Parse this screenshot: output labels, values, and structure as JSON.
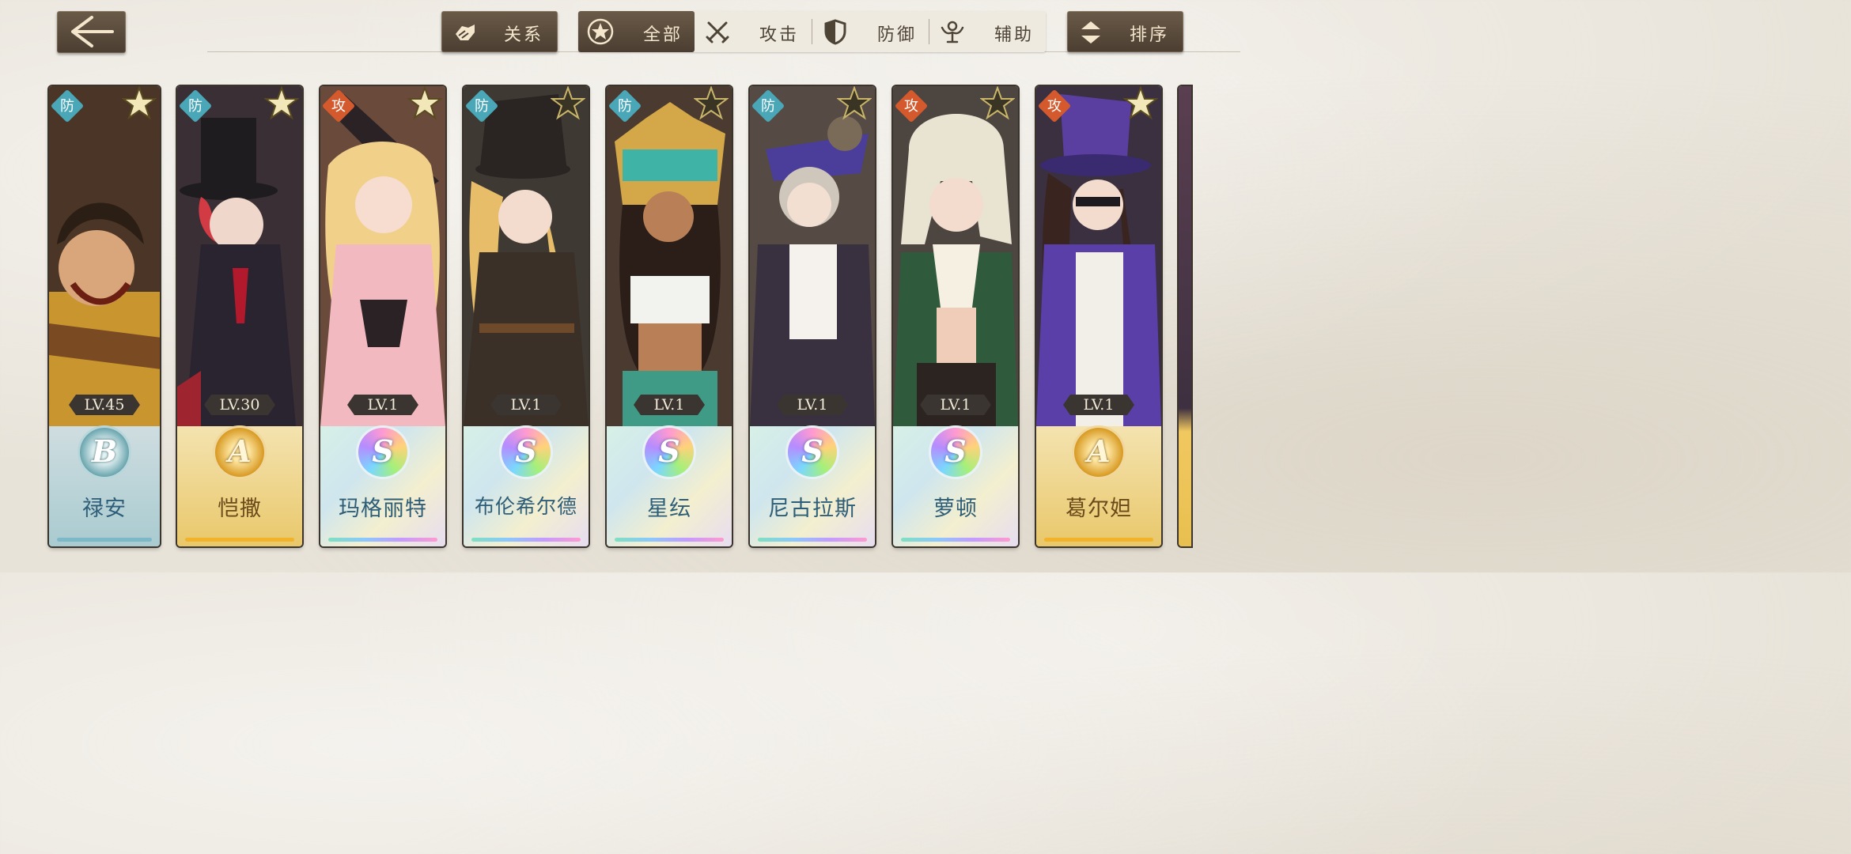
{
  "toolbar": {
    "back_icon": "back-arrow-icon",
    "relation_label": "关系",
    "relation_icon": "handshake-icon",
    "sort_label": "排序",
    "sort_icon": "sort-updown-icon"
  },
  "filters": [
    {
      "label": "全部",
      "icon": "star-circle-icon",
      "active": true
    },
    {
      "label": "攻击",
      "icon": "crossed-swords-icon",
      "active": false
    },
    {
      "label": "防御",
      "icon": "shield-icon",
      "active": false
    },
    {
      "label": "辅助",
      "icon": "support-figure-icon",
      "active": false
    }
  ],
  "cards": [
    {
      "name": "禄安",
      "level": "LV.45",
      "rank": "B",
      "role": "防",
      "role_type": "defense",
      "theme": "blue"
    },
    {
      "name": "恺撒",
      "level": "LV.30",
      "rank": "A",
      "role": "防",
      "role_type": "defense",
      "theme": "gold"
    },
    {
      "name": "玛格丽特",
      "level": "LV.1",
      "rank": "S",
      "role": "攻",
      "role_type": "attack",
      "theme": "rainbow"
    },
    {
      "name": "布伦希尔德",
      "level": "LV.1",
      "rank": "S",
      "role": "防",
      "role_type": "defense",
      "theme": "rainbow"
    },
    {
      "name": "星纭",
      "level": "LV.1",
      "rank": "S",
      "role": "防",
      "role_type": "defense",
      "theme": "rainbow"
    },
    {
      "name": "尼古拉斯",
      "level": "LV.1",
      "rank": "S",
      "role": "防",
      "role_type": "defense",
      "theme": "rainbow"
    },
    {
      "name": "萝顿",
      "level": "LV.1",
      "rank": "S",
      "role": "攻",
      "role_type": "attack",
      "theme": "rainbow"
    },
    {
      "name": "葛尔妲",
      "level": "LV.1",
      "rank": "A",
      "role": "攻",
      "role_type": "attack",
      "theme": "gold"
    }
  ],
  "colors": {
    "button_dark": "#4b3e31",
    "button_text": "#f3e6cc",
    "defense_badge": "#4aa7b8",
    "attack_badge": "#d45a2e",
    "name_blue": "#2e5d77",
    "name_gold": "#6b4a1a"
  }
}
